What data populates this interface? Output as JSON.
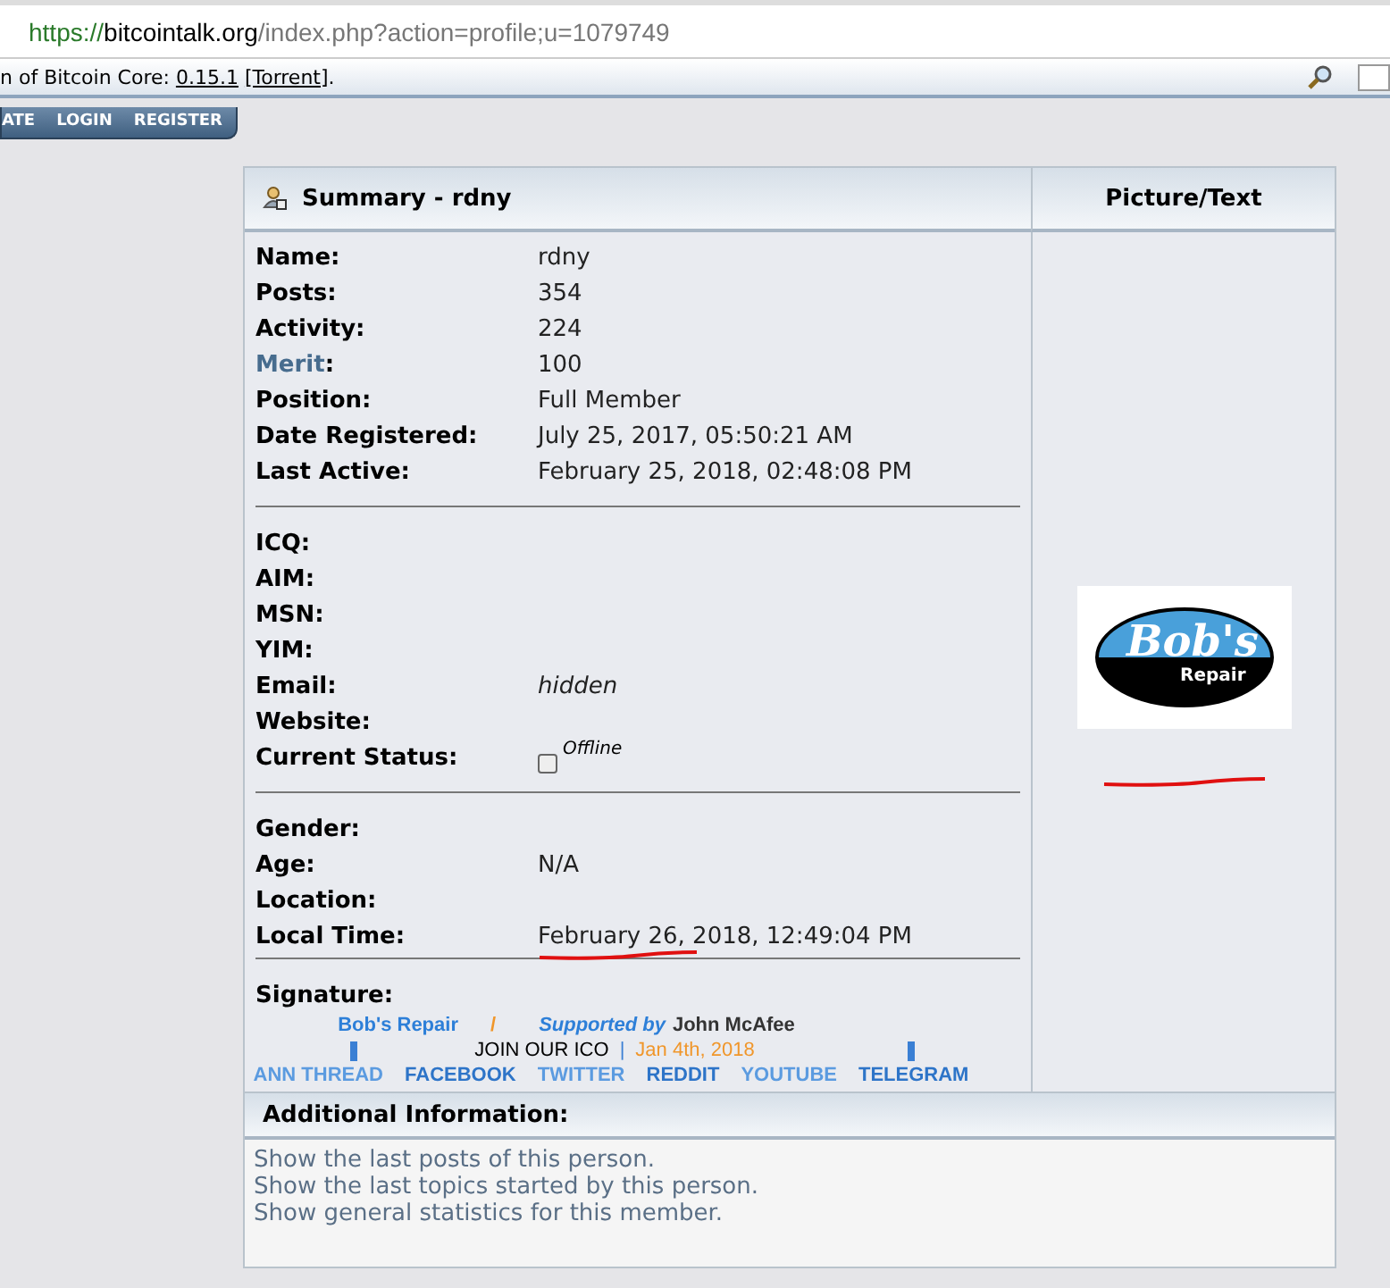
{
  "address_bar": {
    "scheme": "https://",
    "domain": "bitcointalk.org",
    "path": "/index.php?action=profile;u=1079749"
  },
  "news_bar": {
    "prefix": "n of Bitcoin Core: ",
    "link": "0.15.1",
    "link2": "[Torrent]",
    "suffix": "."
  },
  "menu": [
    "ATE",
    "LOGIN",
    "REGISTER"
  ],
  "summary": {
    "title": "Summary - rdny",
    "picture_heading": "Picture/Text",
    "groups": [
      [
        {
          "label": "Name:",
          "value": "rdny",
          "kind": "text"
        },
        {
          "label": "Posts:",
          "value": "354",
          "kind": "text"
        },
        {
          "label": "Activity:",
          "value": "224",
          "kind": "text"
        },
        {
          "label": "Merit",
          "suffix": ":",
          "value": "100",
          "kind": "link"
        },
        {
          "label": "Position:",
          "value": "Full Member",
          "kind": "text"
        },
        {
          "label": "Date Registered:",
          "value": "July 25, 2017, 05:50:21 AM",
          "kind": "text"
        },
        {
          "label": "Last Active:",
          "value": "February 25, 2018, 02:48:08 PM",
          "kind": "text"
        }
      ],
      [
        {
          "label": "ICQ:",
          "kind": "text"
        },
        {
          "label": "AIM:",
          "kind": "text"
        },
        {
          "label": "MSN:",
          "kind": "text"
        },
        {
          "label": "YIM:",
          "kind": "text"
        },
        {
          "label": "Email:",
          "value": "hidden",
          "kind": "italic"
        },
        {
          "label": "Website:",
          "kind": "text"
        },
        {
          "label": "Current Status:",
          "value": "Offline",
          "kind": "status"
        }
      ],
      [
        {
          "label": "Gender:",
          "kind": "text"
        },
        {
          "label": "Age:",
          "value": "N/A",
          "kind": "text"
        },
        {
          "label": "Location:",
          "kind": "text"
        },
        {
          "label": "Local Time:",
          "value": "February 26, 2018, 12:49:04 PM",
          "kind": "underlined"
        }
      ]
    ],
    "signature": {
      "label": "Signature:",
      "lines": [
        [
          {
            "text": "Bob's Repair",
            "kind": "brand"
          },
          {
            "text": "/",
            "kind": "slash"
          },
          {
            "text": "Supported by",
            "kind": "supported"
          },
          {
            "text": "John McAfee",
            "kind": "name"
          }
        ],
        [
          {
            "text": "JOIN OUR ICO",
            "kind": "ico"
          },
          {
            "text": "|",
            "kind": "sep"
          },
          {
            "text": "Jan 4th, 2018",
            "kind": "date"
          }
        ],
        [
          {
            "text": "ANN THREAD",
            "kind": "link"
          },
          {
            "text": "FACEBOOK",
            "kind": "link2"
          },
          {
            "text": "TWITTER",
            "kind": "link"
          },
          {
            "text": "REDDIT",
            "kind": "link2"
          },
          {
            "text": "YOUTUBE",
            "kind": "link"
          },
          {
            "text": "TELEGRAM",
            "kind": "link2"
          }
        ]
      ]
    },
    "logo": {
      "big": "Bob's",
      "small": "Repair"
    }
  },
  "additional": {
    "title": "Additional Information:",
    "links": [
      "Show the last posts of this person.",
      "Show the last topics started by this person.",
      "Show general statistics for this member."
    ]
  }
}
